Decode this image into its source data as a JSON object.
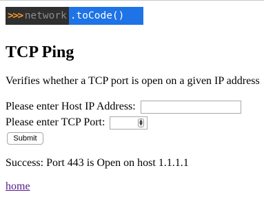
{
  "logo": {
    "arrows": ">>>",
    "network": "network",
    "tocode": ".toCode()"
  },
  "page": {
    "title": "TCP Ping",
    "description": "Verifies whether a TCP port is open on a given IP address"
  },
  "form": {
    "ip_label": "Please enter Host IP Address:",
    "ip_value": "",
    "port_label": "Please enter TCP Port:",
    "port_value": "",
    "spinner_up": "▲",
    "spinner_down": "▼",
    "submit_label": "Submit"
  },
  "result": {
    "message": "Success: Port 443 is Open on host 1.1.1.1"
  },
  "nav": {
    "home_label": "home"
  },
  "colors": {
    "logo_bg": "#2f2f2f",
    "logo_arrows": "#f09a2a",
    "logo_highlight": "#1e73e6",
    "visited_link": "#551a8b"
  }
}
